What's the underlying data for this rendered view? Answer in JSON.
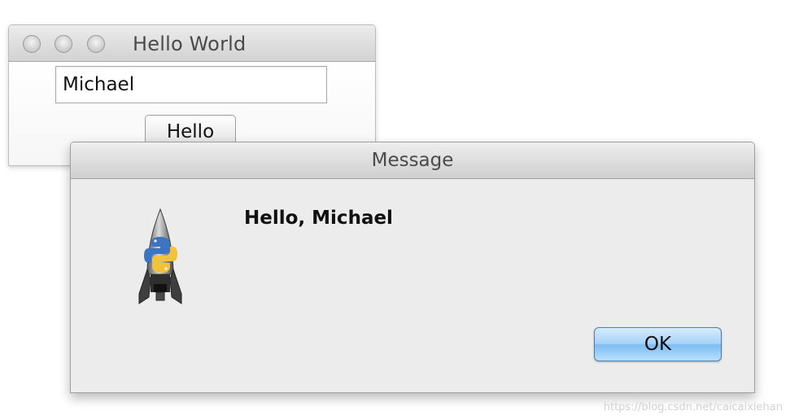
{
  "main_window": {
    "title": "Hello World",
    "name_field_value": "Michael",
    "hello_button_label": "Hello"
  },
  "message_dialog": {
    "title": "Message",
    "message": "Hello, Michael",
    "ok_button_label": "OK",
    "icon": "python-rocket-icon"
  },
  "watermark": "https://blog.csdn.net/caicaixiehan"
}
